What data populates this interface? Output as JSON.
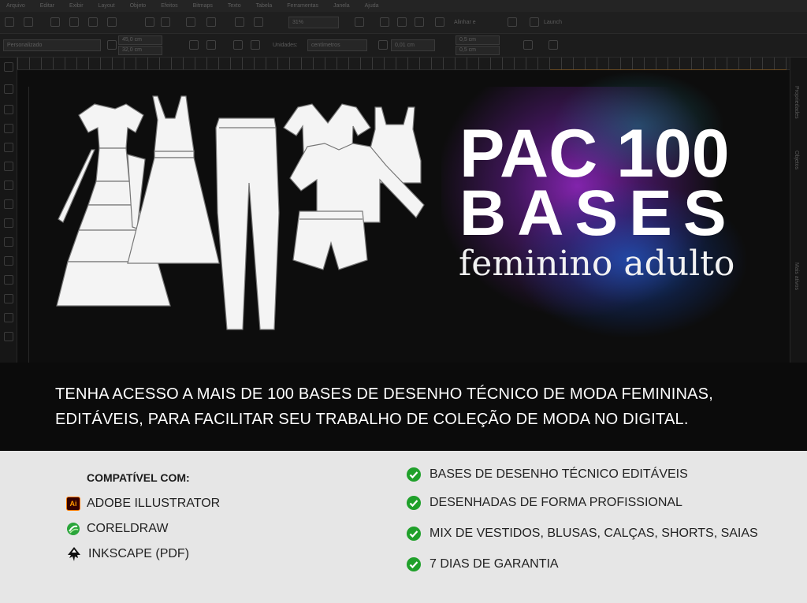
{
  "app": {
    "menu": [
      "Arquivo",
      "Editar",
      "Exibir",
      "Layout",
      "Objeto",
      "Efeitos",
      "Bitmaps",
      "Texto",
      "Tabela",
      "Ferramentas",
      "Janela",
      "Ajuda"
    ],
    "toolbar": {
      "zoom": "31%",
      "align_label": "Alinhar e",
      "launch_label": "Launch",
      "preset": "Personalizado",
      "width": "45,0 cm",
      "height": "32,0 cm",
      "units_label": "Unidades:",
      "units_value": "centímetros",
      "nudge": "0,01 cm",
      "dup_x": "0,5 cm",
      "dup_y": "0,5 cm"
    },
    "side_tabs": [
      "Propriedades",
      "Objetos",
      "Mais ativos"
    ]
  },
  "hero": {
    "title_line1": "PAC 100",
    "title_line2": "BASES",
    "subtitle": "feminino adulto",
    "description_line1": "TENHA ACESSO A MAIS DE 100 BASES DE DESENHO TÉCNICO DE MODA FEMININAS,",
    "description_line2": "EDITÁVEIS, PARA FACILITAR SEU TRABALHO DE COLEÇÃO DE MODA NO DIGITAL."
  },
  "compatibility": {
    "title": "COMPATÍVEL COM:",
    "items": [
      {
        "label": "ADOBE ILLUSTRATOR",
        "icon": "adobe-illustrator-icon",
        "badge": "Ai"
      },
      {
        "label": "CORELDRAW",
        "icon": "coreldraw-icon"
      },
      {
        "label": "INKSCAPE (PDF)",
        "icon": "inkscape-icon"
      }
    ]
  },
  "features": [
    "BASES DE DESENHO TÉCNICO EDITÁVEIS",
    "DESENHADAS DE FORMA PROFISSIONAL",
    "MIX DE VESTIDOS, BLUSAS, CALÇAS, SHORTS, SAIAS",
    "7 DIAS DE GARANTIA"
  ],
  "colors": {
    "check_green": "#1fa02a",
    "footer_bg": "#e6e6e6",
    "glow_purple": "#9628c8",
    "glow_blue": "#1e5ac8"
  }
}
